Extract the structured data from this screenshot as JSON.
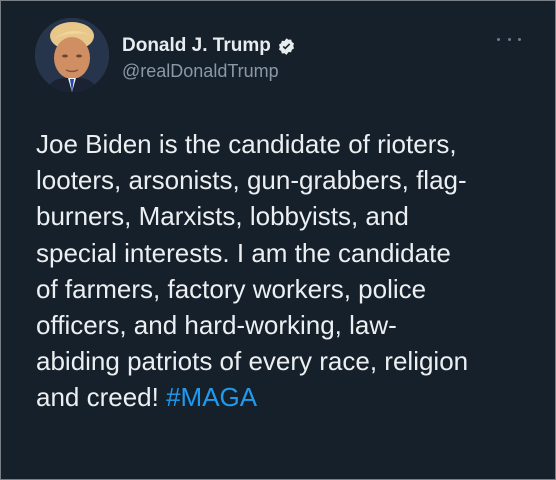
{
  "tweet": {
    "author": {
      "name": "Donald J. Trump",
      "handle": "@realDonaldTrump",
      "verified_icon": "verified-badge-icon",
      "avatar_icon": "profile-photo"
    },
    "more_icon": "more-options-icon",
    "text_lines": [
      "Joe Biden is the candidate of rioters,",
      "looters, arsonists, gun-grabbers, flag-",
      "burners, Marxists, lobbyists, and",
      "special interests. I am the candidate",
      "of farmers, factory workers, police",
      "officers, and hard-working, law-",
      "abiding patriots of every race, religion",
      "and creed! "
    ],
    "hashtag": "#MAGA"
  },
  "colors": {
    "background": "#15202b",
    "text": "#eceff1",
    "secondary_text": "#8b98a5",
    "accent": "#1d9bf0"
  }
}
